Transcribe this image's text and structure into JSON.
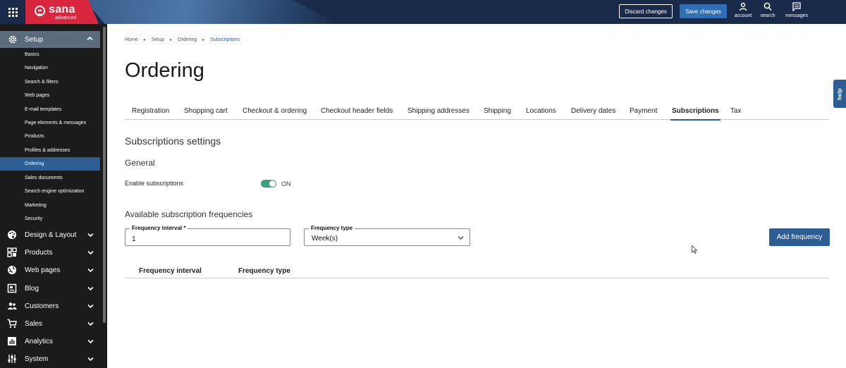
{
  "topbar": {
    "brand_name": "sana",
    "brand_edition": "advanced",
    "discard_label": "Discard changes",
    "save_label": "Save changes",
    "actions": [
      {
        "label": "account",
        "icon": "person-icon"
      },
      {
        "label": "search",
        "icon": "search-icon"
      },
      {
        "label": "messages",
        "icon": "message-icon"
      }
    ]
  },
  "sidebar": {
    "section": {
      "label": "Setup",
      "icon": "gear-icon",
      "expanded": true
    },
    "sub_items": [
      {
        "label": "Basics"
      },
      {
        "label": "Navigation"
      },
      {
        "label": "Search & filters"
      },
      {
        "label": "Web pages"
      },
      {
        "label": "E-mail templates"
      },
      {
        "label": "Page elements & messages"
      },
      {
        "label": "Products"
      },
      {
        "label": "Profiles & addresses"
      },
      {
        "label": "Ordering",
        "active": true
      },
      {
        "label": "Sales documents"
      },
      {
        "label": "Search engine optimization"
      },
      {
        "label": "Marketing"
      },
      {
        "label": "Security"
      }
    ],
    "main_items": [
      {
        "label": "Design & Layout",
        "icon": "palette-icon"
      },
      {
        "label": "Products",
        "icon": "products-grid-icon"
      },
      {
        "label": "Web pages",
        "icon": "globe-icon"
      },
      {
        "label": "Blog",
        "icon": "blog-icon"
      },
      {
        "label": "Customers",
        "icon": "customers-icon"
      },
      {
        "label": "Sales",
        "icon": "cart-icon"
      },
      {
        "label": "Analytics",
        "icon": "analytics-icon"
      },
      {
        "label": "System",
        "icon": "system-icon"
      }
    ]
  },
  "breadcrumb": [
    "Home",
    "Setup",
    "Ordering",
    "Subscriptions"
  ],
  "page_title": "Ordering",
  "tabs": [
    {
      "label": "Registration"
    },
    {
      "label": "Shopping cart"
    },
    {
      "label": "Checkout & ordering"
    },
    {
      "label": "Checkout header fields"
    },
    {
      "label": "Shipping addresses"
    },
    {
      "label": "Shipping"
    },
    {
      "label": "Locations"
    },
    {
      "label": "Delivery dates"
    },
    {
      "label": "Payment"
    },
    {
      "label": "Subscriptions",
      "active": true
    },
    {
      "label": "Tax"
    }
  ],
  "settings": {
    "heading": "Subscriptions settings",
    "general_heading": "General",
    "enable_label": "Enable subscriptions",
    "enable_state": "ON",
    "enabled": true
  },
  "frequencies": {
    "heading": "Available subscription frequencies",
    "interval_label": "Frequency interval *",
    "interval_value": "1",
    "type_label": "Frequency type",
    "type_value": "Week(s)",
    "add_label": "Add frequency",
    "columns": [
      "Frequency interval",
      "Frequency type"
    ]
  },
  "help_label": "help",
  "colors": {
    "accent": "#2d5e93",
    "brand": "#d7263d",
    "toggle_on": "#3aa17a",
    "topbar": "#1a2a4a"
  }
}
